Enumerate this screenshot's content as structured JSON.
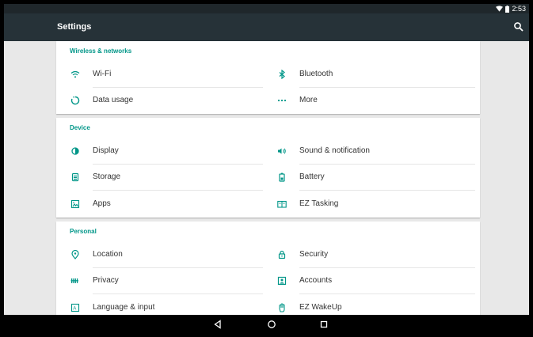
{
  "status": {
    "time": "2:53",
    "wifi_icon": "wifi-icon",
    "battery_icon": "battery-icon"
  },
  "appbar": {
    "title": "Settings",
    "search_icon": "search-icon"
  },
  "colors": {
    "accent": "#009688",
    "appbar": "#263238",
    "statusbar": "#1f272b",
    "background": "#e8e8e8"
  },
  "sections": [
    {
      "header": "Wireless & networks",
      "items": [
        {
          "label": "Wi-Fi",
          "icon": "wifi-icon"
        },
        {
          "label": "Bluetooth",
          "icon": "bluetooth-icon"
        },
        {
          "label": "Data usage",
          "icon": "data-usage-icon"
        },
        {
          "label": "More",
          "icon": "more-icon"
        }
      ]
    },
    {
      "header": "Device",
      "items": [
        {
          "label": "Display",
          "icon": "display-icon"
        },
        {
          "label": "Sound & notification",
          "icon": "sound-icon"
        },
        {
          "label": "Storage",
          "icon": "storage-icon"
        },
        {
          "label": "Battery",
          "icon": "battery-icon"
        },
        {
          "label": "Apps",
          "icon": "apps-icon"
        },
        {
          "label": "EZ Tasking",
          "icon": "ez-tasking-icon"
        }
      ]
    },
    {
      "header": "Personal",
      "items": [
        {
          "label": "Location",
          "icon": "location-icon"
        },
        {
          "label": "Security",
          "icon": "lock-icon"
        },
        {
          "label": "Privacy",
          "icon": "privacy-icon"
        },
        {
          "label": "Accounts",
          "icon": "accounts-icon"
        },
        {
          "label": "Language & input",
          "icon": "keyboard-icon"
        },
        {
          "label": "EZ WakeUp",
          "icon": "hand-icon"
        }
      ]
    }
  ],
  "navbar": {
    "back_icon": "back-icon",
    "home_icon": "home-icon",
    "recents_icon": "recents-icon"
  }
}
